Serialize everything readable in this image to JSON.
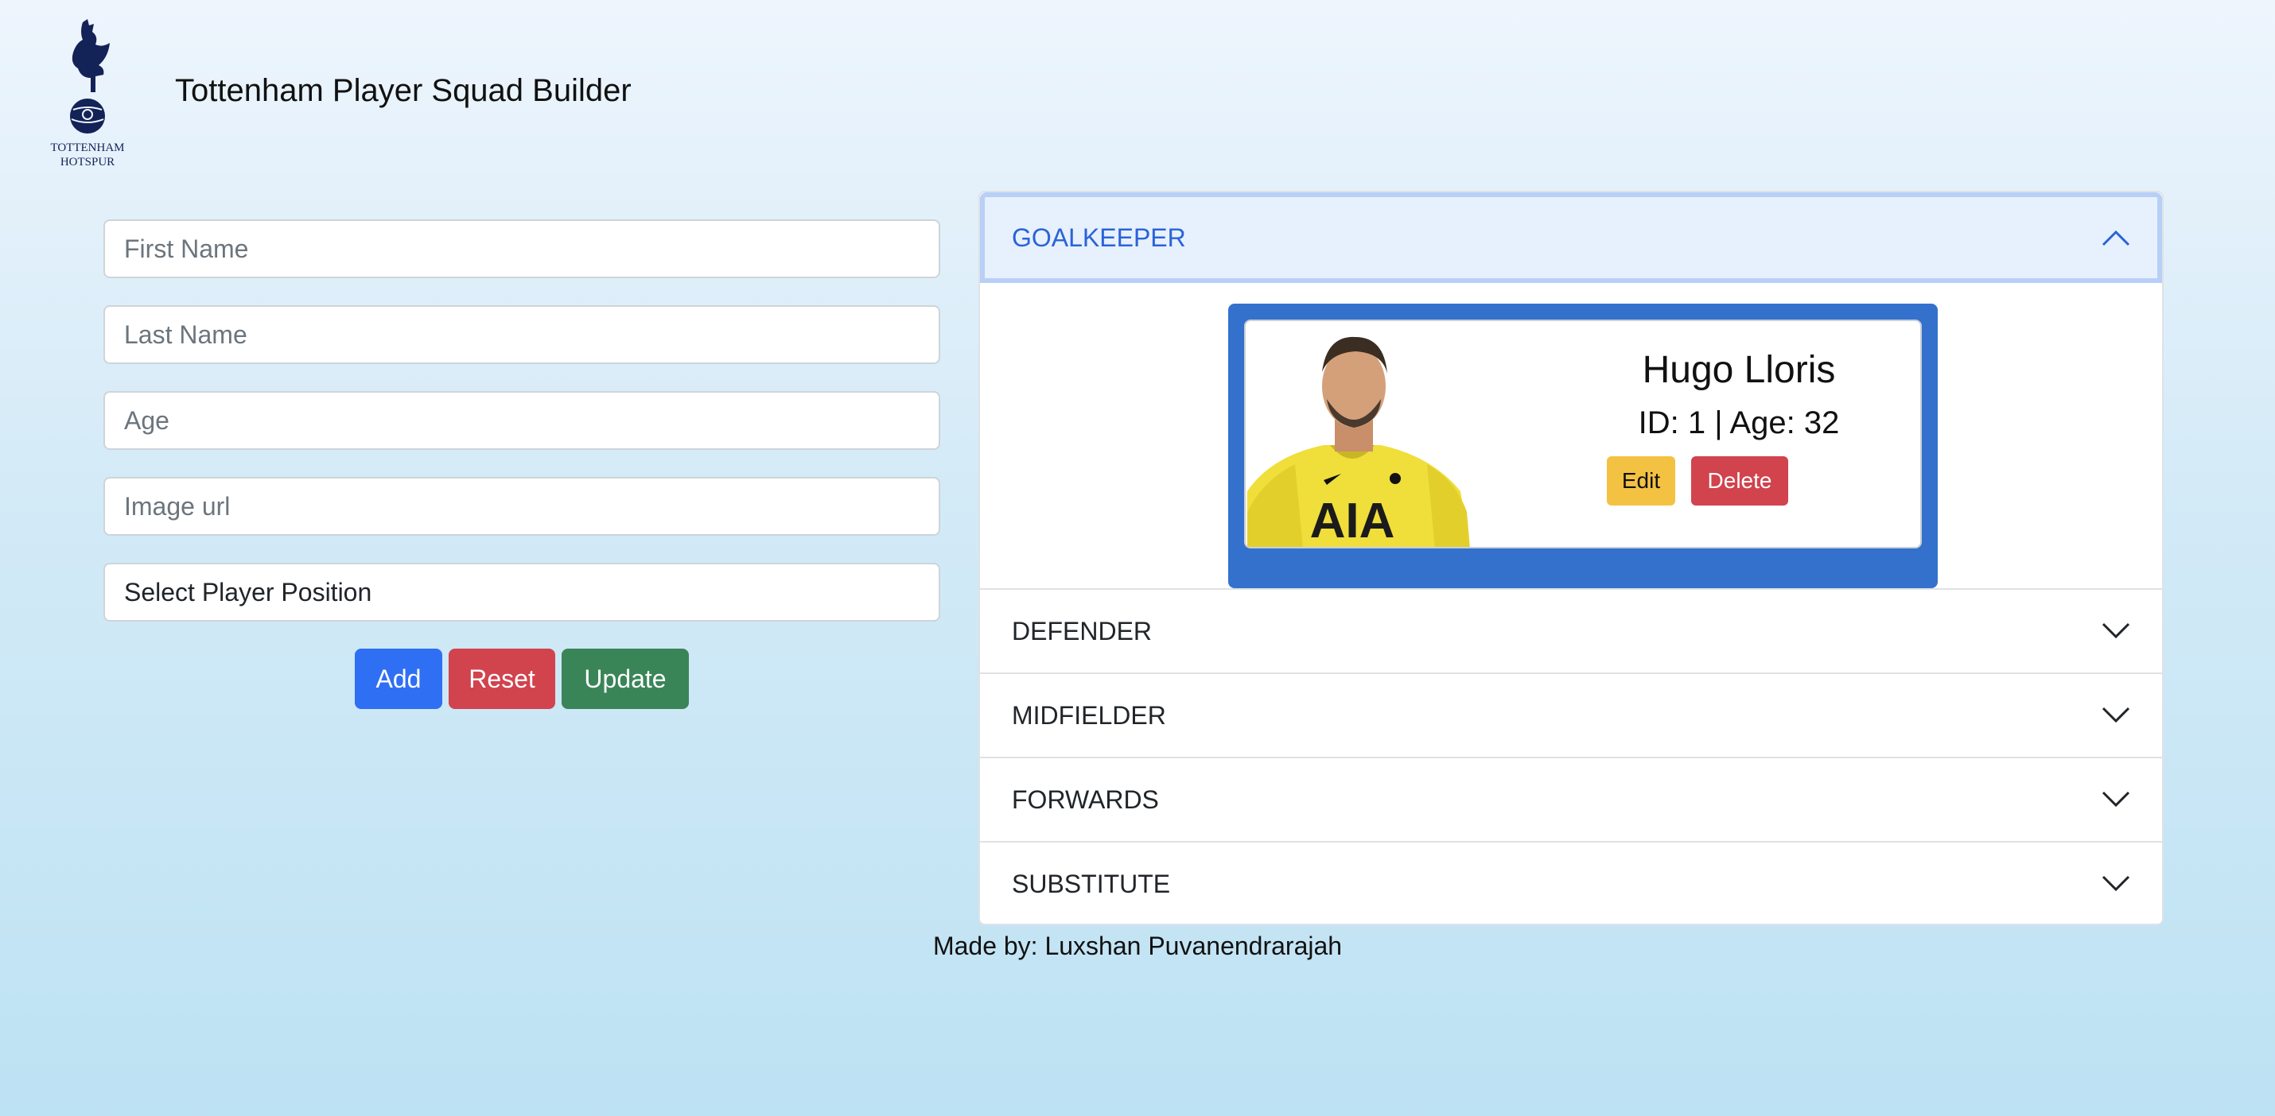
{
  "header": {
    "title": "Tottenham Player Squad Builder",
    "logo_text_line1": "TOTTENHAM",
    "logo_text_line2": "HOTSPUR"
  },
  "form": {
    "first_name_placeholder": "First Name",
    "last_name_placeholder": "Last Name",
    "age_placeholder": "Age",
    "image_url_placeholder": "Image url",
    "position_select_value": "Select Player Position",
    "add_label": "Add",
    "reset_label": "Reset",
    "update_label": "Update"
  },
  "accordion": {
    "sections": [
      {
        "label": "GOALKEEPER",
        "expanded": true
      },
      {
        "label": "DEFENDER",
        "expanded": false
      },
      {
        "label": "MIDFIELDER",
        "expanded": false
      },
      {
        "label": "FORWARDS",
        "expanded": false
      },
      {
        "label": "SUBSTITUTE",
        "expanded": false
      }
    ]
  },
  "player_card": {
    "name": "Hugo Lloris",
    "meta": "ID: 1 | Age: 32",
    "edit_label": "Edit",
    "delete_label": "Delete",
    "shirt_sponsor": "AIA"
  },
  "footer": {
    "text": "Made by: Luxshan Puvanendrarajah"
  },
  "colors": {
    "primary": "#2f6ff3",
    "danger": "#d1434d",
    "success": "#3a8558",
    "warning": "#f4c242",
    "card_border": "#3471cd",
    "active_header_text": "#2a63d8"
  }
}
